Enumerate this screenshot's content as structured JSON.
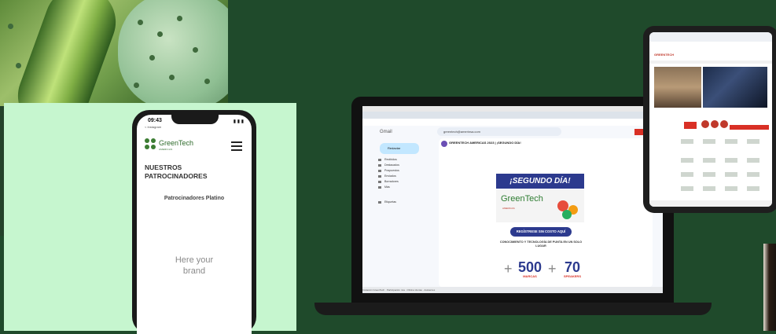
{
  "phone": {
    "time": "09:43",
    "sub": "< Instagram",
    "status": "▮ ▮ ▮",
    "brand": "GreenTech",
    "brand_sub": "AMERICAS",
    "heading": "NUESTROS PATROCINADORES",
    "subheading": "Patrocinadores Platino",
    "placeholder": "Here your brand"
  },
  "laptop": {
    "gmail_label": "Gmail",
    "search_text": "greentech@amerinsa.com",
    "compose": "Redactar",
    "nav": [
      "Recibidos",
      "Destacados",
      "Pospuestos",
      "Enviados",
      "Borradores",
      "Más",
      "Etiquetas"
    ],
    "email_subject": "GREENTECH AMERICAS 2023 | ¡SEGUNDO DÍA!",
    "banner": "¡SEGUNDO DÍA!",
    "logo_brand": "GreenTech",
    "logo_sub": "AMERICAS",
    "cta": "REGÍSTRESE SIN COSTO AQUÍ",
    "tagline": "CONOCIMIENTO Y TECNOLOGÍA DE PUNTA EN UN SOLO LUGAR",
    "stat1_value": "500",
    "stat1_label": "MARCAS",
    "stat2_value": "70",
    "stat2_label": "SPEAKERS",
    "bottom_bar": "Invitación GreenTech ·  Participación mía  ·  Oficina Ventas  ·  Asistentes"
  },
  "tablet": {
    "logo": "GREENTECH"
  },
  "colors": {
    "background": "#1f4a2b",
    "mint": "#c6f6cf",
    "brand_green": "#2e7d32",
    "banner_blue": "#2c3a8e",
    "accent_red": "#d93025"
  }
}
